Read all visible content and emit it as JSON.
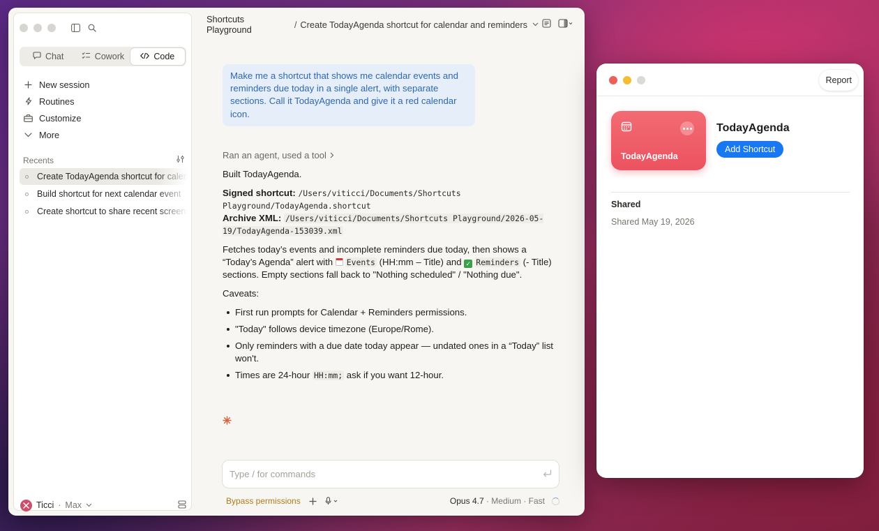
{
  "sidebar": {
    "modes": [
      {
        "label": "Chat",
        "icon": "chat-bubble-icon"
      },
      {
        "label": "Cowork",
        "icon": "checklist-icon"
      },
      {
        "label": "Code",
        "icon": "code-icon"
      }
    ],
    "active_mode": "Code",
    "nav": [
      {
        "label": "New session",
        "icon": "plus-icon"
      },
      {
        "label": "Routines",
        "icon": "bolt-icon"
      },
      {
        "label": "Customize",
        "icon": "briefcase-icon"
      },
      {
        "label": "More",
        "icon": "chevron-down-icon"
      }
    ],
    "recents_label": "Recents",
    "recents": [
      {
        "label": "Create TodayAgenda shortcut for calendar and reminders",
        "active": true
      },
      {
        "label": "Build shortcut for next calendar event",
        "active": false
      },
      {
        "label": "Create shortcut to share recent screenshots",
        "active": false
      }
    ],
    "account": {
      "name": "Ticci",
      "plan": "Max"
    }
  },
  "header": {
    "project": "Shortcuts Playground",
    "separator": "/",
    "conversation": "Create TodayAgenda shortcut for calendar and reminders"
  },
  "chat": {
    "user_message": "Make me a shortcut that shows me calendar events and reminders due today in a single alert, with separate sections. Call it TodayAgenda and give it a red calendar icon.",
    "agent_meta": "Ran an agent, used a tool",
    "built": "Built TodayAgenda.",
    "signed_label": "Signed shortcut:",
    "signed_path": "/Users/viticci/Documents/Shortcuts Playground/TodayAgenda.shortcut",
    "archive_label": "Archive XML:",
    "archive_path": "/Users/viticci/Documents/Shortcuts Playground/2026-05-19/TodayAgenda-153039.xml",
    "fetch_1": "Fetches today’s events and incomplete reminders due today, then shows a “Today’s Agenda” alert with",
    "events_code": "Events",
    "fetch_2": "(HH:mm – Title) and",
    "reminders_code": "Reminders",
    "fetch_3": "(- Title) sections. Empty sections fall back to \"Nothing scheduled\" / \"Nothing due\".",
    "caveats_label": "Caveats:",
    "caveat_1": "First run prompts for Calendar + Reminders permissions.",
    "caveat_2": "\"Today\" follows device timezone (Europe/Rome).",
    "caveat_3": "Only reminders with a due date today appear — undated ones in a “Today” list won't.",
    "caveat_4_a": "Times are 24-hour",
    "caveat_4_code": "HH:mm;",
    "caveat_4_b": "ask if you want 12-hour."
  },
  "composer": {
    "placeholder": "Type / for commands",
    "bypass": "Bypass permissions",
    "model": "Opus 4.7",
    "effort": "· Medium",
    "speed": "· Fast"
  },
  "shortcut_window": {
    "report": "Report",
    "tile_name": "TodayAgenda",
    "title": "TodayAgenda",
    "add_button": "Add Shortcut",
    "shared_title": "Shared",
    "shared_date": "Shared May 19, 2026",
    "tile_color": "#ec5260",
    "button_color": "#1778f2"
  }
}
